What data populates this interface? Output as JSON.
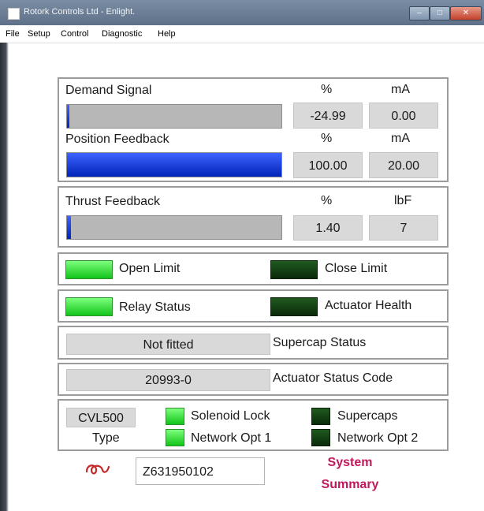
{
  "window": {
    "title": "Rotork Controls Ltd - Enlight."
  },
  "menu": [
    "File",
    "Setup",
    "Control",
    "Diagnostic",
    "Help"
  ],
  "demand": {
    "label": "Demand Signal",
    "unit_pct": "%",
    "unit_ma": "mA",
    "pct": "-24.99",
    "ma": "0.00",
    "level": 0.0
  },
  "position": {
    "label": "Position Feedback",
    "unit_pct": "%",
    "unit_ma": "mA",
    "pct": "100.00",
    "ma": "20.00",
    "level": 1.0
  },
  "thrust": {
    "label": "Thrust Feedback",
    "unit_pct": "%",
    "unit_lbf": "lbF",
    "pct": "1.40",
    "lbf": "7",
    "level": 0.014
  },
  "limits": {
    "open_label": "Open Limit",
    "open_on": true,
    "close_label": "Close Limit",
    "close_on": false
  },
  "status": {
    "relay_label": "Relay Status",
    "relay_on": true,
    "health_label": "Actuator Health",
    "health_on": false
  },
  "supercap": {
    "value": "Not fitted",
    "label": "Supercap Status"
  },
  "status_code": {
    "value": "20993-0",
    "label": "Actuator Status Code"
  },
  "type": {
    "value": "CVL500",
    "label": "Type"
  },
  "options": {
    "solenoid_label": "Solenoid Lock",
    "solenoid_on": true,
    "supercaps_label": "Supercaps",
    "supercaps_on": false,
    "net1_label": "Network Opt 1",
    "net1_on": true,
    "net2_label": "Network Opt 2",
    "net2_on": false
  },
  "footer": {
    "serial": "Z631950102",
    "summary_line1": "System",
    "summary_line2": "Summary"
  },
  "colors": {
    "led_on": "#22dd22",
    "led_off": "#0f3d0f",
    "bar_fill": "#0a35e0",
    "summary_text": "#c2185b"
  }
}
